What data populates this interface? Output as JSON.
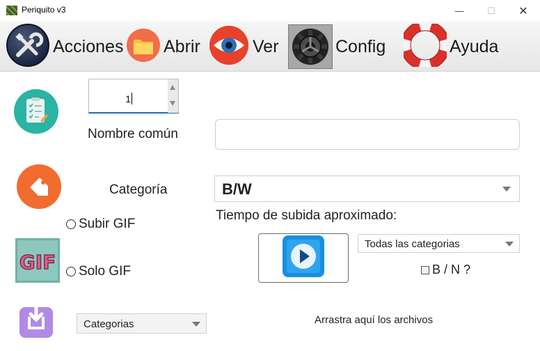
{
  "window": {
    "title": "Periquito v3",
    "minimize": "—",
    "maximize": "☐",
    "close": "✕"
  },
  "toolbar": {
    "acciones": "Acciones",
    "abrir": "Abrir",
    "ver": "Ver",
    "config": "Config",
    "ayuda": "Ayuda"
  },
  "form": {
    "number_value": "1",
    "nombre_label": "Nombre común",
    "nombre_value": "",
    "categoria_label": "Categoría",
    "categoria_value": "B/W",
    "tiempo_label": "Tiempo de subida aproximado:",
    "subir_gif_label": "Subir GIF",
    "solo_gif_label": "Solo GIF",
    "todas_categorias_value": "Todas las categorias",
    "bn_label": "B / N ?",
    "categorias_value": "Categorias",
    "arrastra_label": "Arrastra aquí los archivos",
    "gif_logo_text": "GIF"
  },
  "colors": {
    "teal": "#2bb3a3",
    "orange": "#f16c2e",
    "purple": "#b18ae6",
    "play_blue": "#1a8fe0",
    "spinner_underline": "#1f6fb5"
  }
}
